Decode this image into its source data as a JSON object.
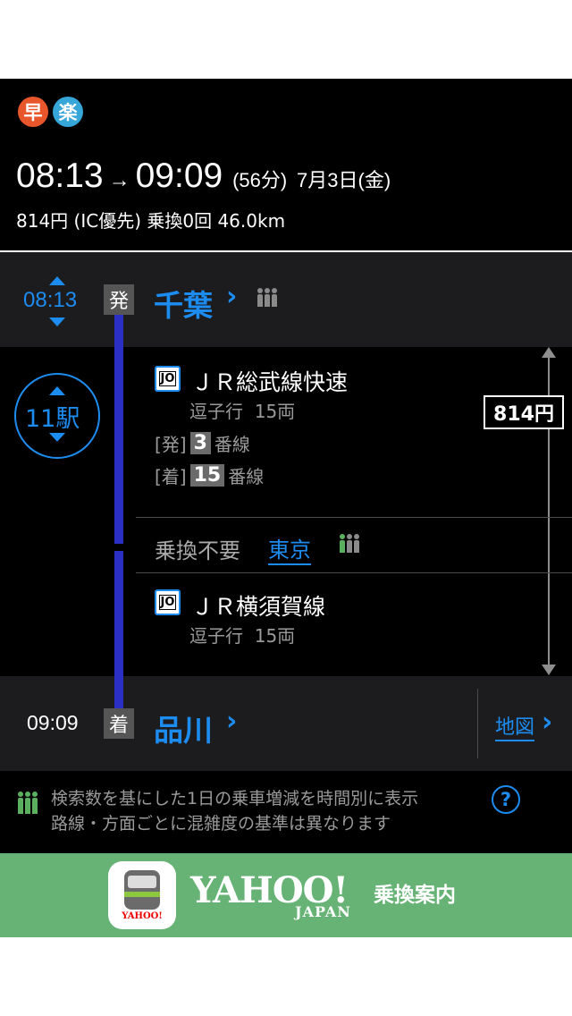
{
  "summary": {
    "badge_fast": "早",
    "badge_easy": "楽",
    "depart_time": "08:13",
    "arrow": "→",
    "arrive_time": "09:09",
    "duration": "(56分)",
    "date": "7月3日(金)",
    "fare_info": "814円 (IC優先)",
    "transfers": "乗換0回",
    "distance": "46.0km"
  },
  "departure": {
    "time": "08:13",
    "tag": "発",
    "station": "千葉",
    "chevron": "›"
  },
  "stop_count": "11駅",
  "fare_total": "814円",
  "segment1": {
    "line_badge": "JO",
    "line_name": "ＪＲ総武線快速",
    "direction": "逗子行",
    "cars": "15両",
    "dep_label": "[発]",
    "dep_platform": "3",
    "arr_label": "[着]",
    "arr_platform": "15",
    "platform_suffix": "番線"
  },
  "transfer": {
    "label": "乗換不要",
    "station": "東京"
  },
  "segment2": {
    "line_badge": "JO",
    "line_name": "ＪＲ横須賀線",
    "direction": "逗子行",
    "cars": "15両"
  },
  "arrival": {
    "time": "09:09",
    "tag": "着",
    "station": "品川",
    "chevron": "›",
    "map_link": "地図",
    "map_chevron": "›"
  },
  "legend": {
    "line1": "検索数を基にした1日の乗車増減を時間別に表示",
    "line2": "路線・方面ごとに混雑度の基準は異なります",
    "help": "?"
  },
  "banner": {
    "brand": "YAHOO!",
    "brand_sub": "JAPAN",
    "app_name": "乗換案内",
    "icon_label": "YAHOO!"
  },
  "colors": {
    "accent": "#1d8cf0",
    "line": "#2b2fc4",
    "banner": "#67b275",
    "crowd_normal": "#8a8a8a",
    "crowd_transfer": "#5bb05f"
  }
}
